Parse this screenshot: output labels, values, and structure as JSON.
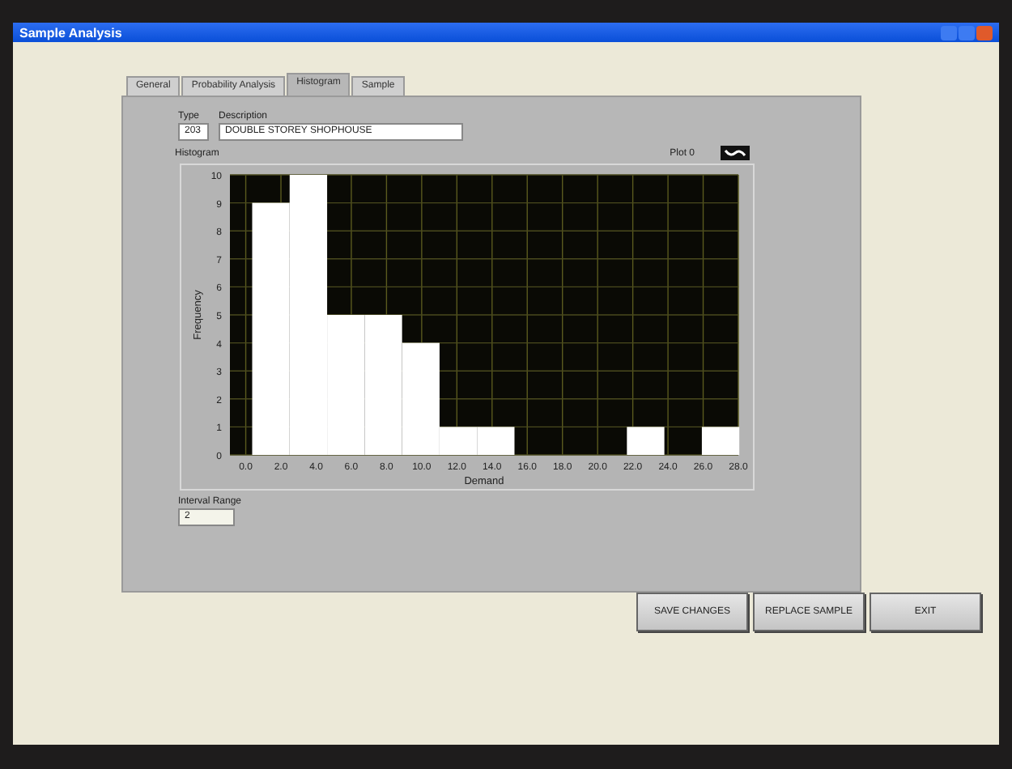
{
  "window": {
    "title": "Sample Analysis"
  },
  "tabs": [
    {
      "label": "General",
      "selected": false
    },
    {
      "label": "Probability Analysis",
      "selected": false
    },
    {
      "label": "Histogram",
      "selected": true
    },
    {
      "label": "Sample",
      "selected": false
    }
  ],
  "type": {
    "label": "Type",
    "value": "203"
  },
  "description": {
    "label": "Description",
    "value": "DOUBLE STOREY SHOPHOUSE"
  },
  "histogram": {
    "label": "Histogram",
    "chart_data": {
      "type": "bar",
      "grid": true,
      "xlabel": "Demand",
      "ylabel": "Frequency",
      "x": [
        1.43,
        3.56,
        5.69,
        7.82,
        9.95,
        12.08,
        14.21,
        16.34,
        18.47,
        20.6,
        22.73,
        24.86,
        26.99
      ],
      "series": [
        {
          "name": "Plot 0",
          "color": "#ffffff",
          "values": [
            9,
            10,
            5,
            5,
            4,
            1,
            1,
            0,
            0,
            0,
            1,
            0,
            1
          ]
        }
      ],
      "xlim": [
        -0.9,
        28
      ],
      "ylim": [
        0,
        10
      ],
      "xticks": [
        {
          "value": 0,
          "label": "0.0"
        },
        {
          "value": 2,
          "label": "2.0"
        },
        {
          "value": 4,
          "label": "4.0"
        },
        {
          "value": 6,
          "label": "6.0"
        },
        {
          "value": 8,
          "label": "8.0"
        },
        {
          "value": 10,
          "label": "10.0"
        },
        {
          "value": 12,
          "label": "12.0"
        },
        {
          "value": 14,
          "label": "14.0"
        },
        {
          "value": 16,
          "label": "16.0"
        },
        {
          "value": 18,
          "label": "18.0"
        },
        {
          "value": 20,
          "label": "20.0"
        },
        {
          "value": 22,
          "label": "22.0"
        },
        {
          "value": 24,
          "label": "24.0"
        },
        {
          "value": 26,
          "label": "26.0"
        },
        {
          "value": 28,
          "label": "28.0"
        }
      ],
      "yticks": [
        0,
        1,
        2,
        3,
        4,
        5,
        6,
        7,
        8,
        9,
        10
      ]
    }
  },
  "interval_range": {
    "label": "Interval Range",
    "value": "2"
  },
  "buttons": [
    "SAVE CHANGES",
    "REPLACE SAMPLE",
    "EXIT"
  ]
}
